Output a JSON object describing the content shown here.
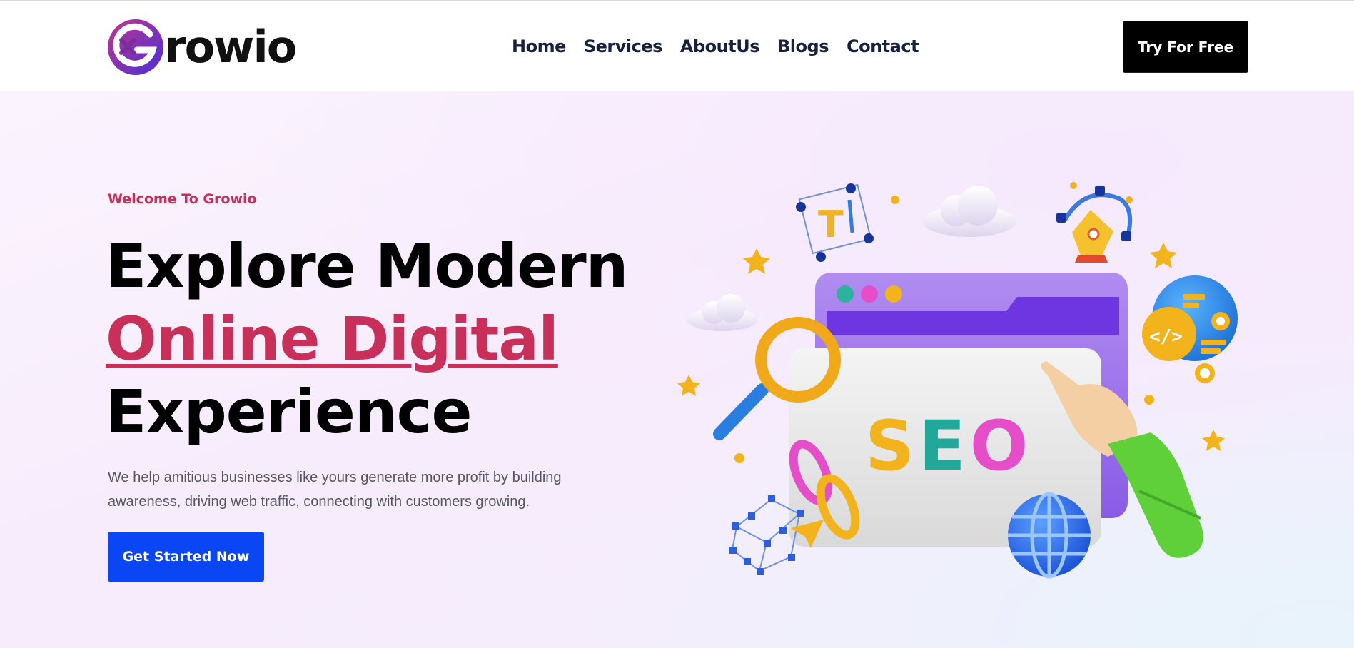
{
  "brand": {
    "logo_text": "rowio",
    "logo_letter": "G"
  },
  "nav": {
    "items": [
      "Home",
      "Services",
      "AboutUs",
      "Blogs",
      "Contact"
    ],
    "cta_label": "Try For Free"
  },
  "hero": {
    "eyebrow": "Welcome To Growio",
    "headline_line1": "Explore Modern",
    "headline_accent": "Online Digital",
    "headline_line3": "Experience",
    "description": "We help amitious businesses like yours generate more profit by building awareness, driving web traffic, connecting with customers growing.",
    "cta_label": "Get Started Now",
    "illustration_text": "SEO"
  },
  "colors": {
    "accent": "#c8305a",
    "primary_button": "#0b46f5",
    "dark_button": "#000000",
    "nav_text": "#16213e"
  },
  "icons": [
    "logo-g-icon",
    "text-tool-icon",
    "pen-tool-icon",
    "code-icon",
    "magnifier-icon",
    "link-chain-icon",
    "globe-icon",
    "pointing-hand-icon",
    "cube-icon",
    "paper-plane-icon",
    "cloud-icon",
    "star-icon"
  ]
}
